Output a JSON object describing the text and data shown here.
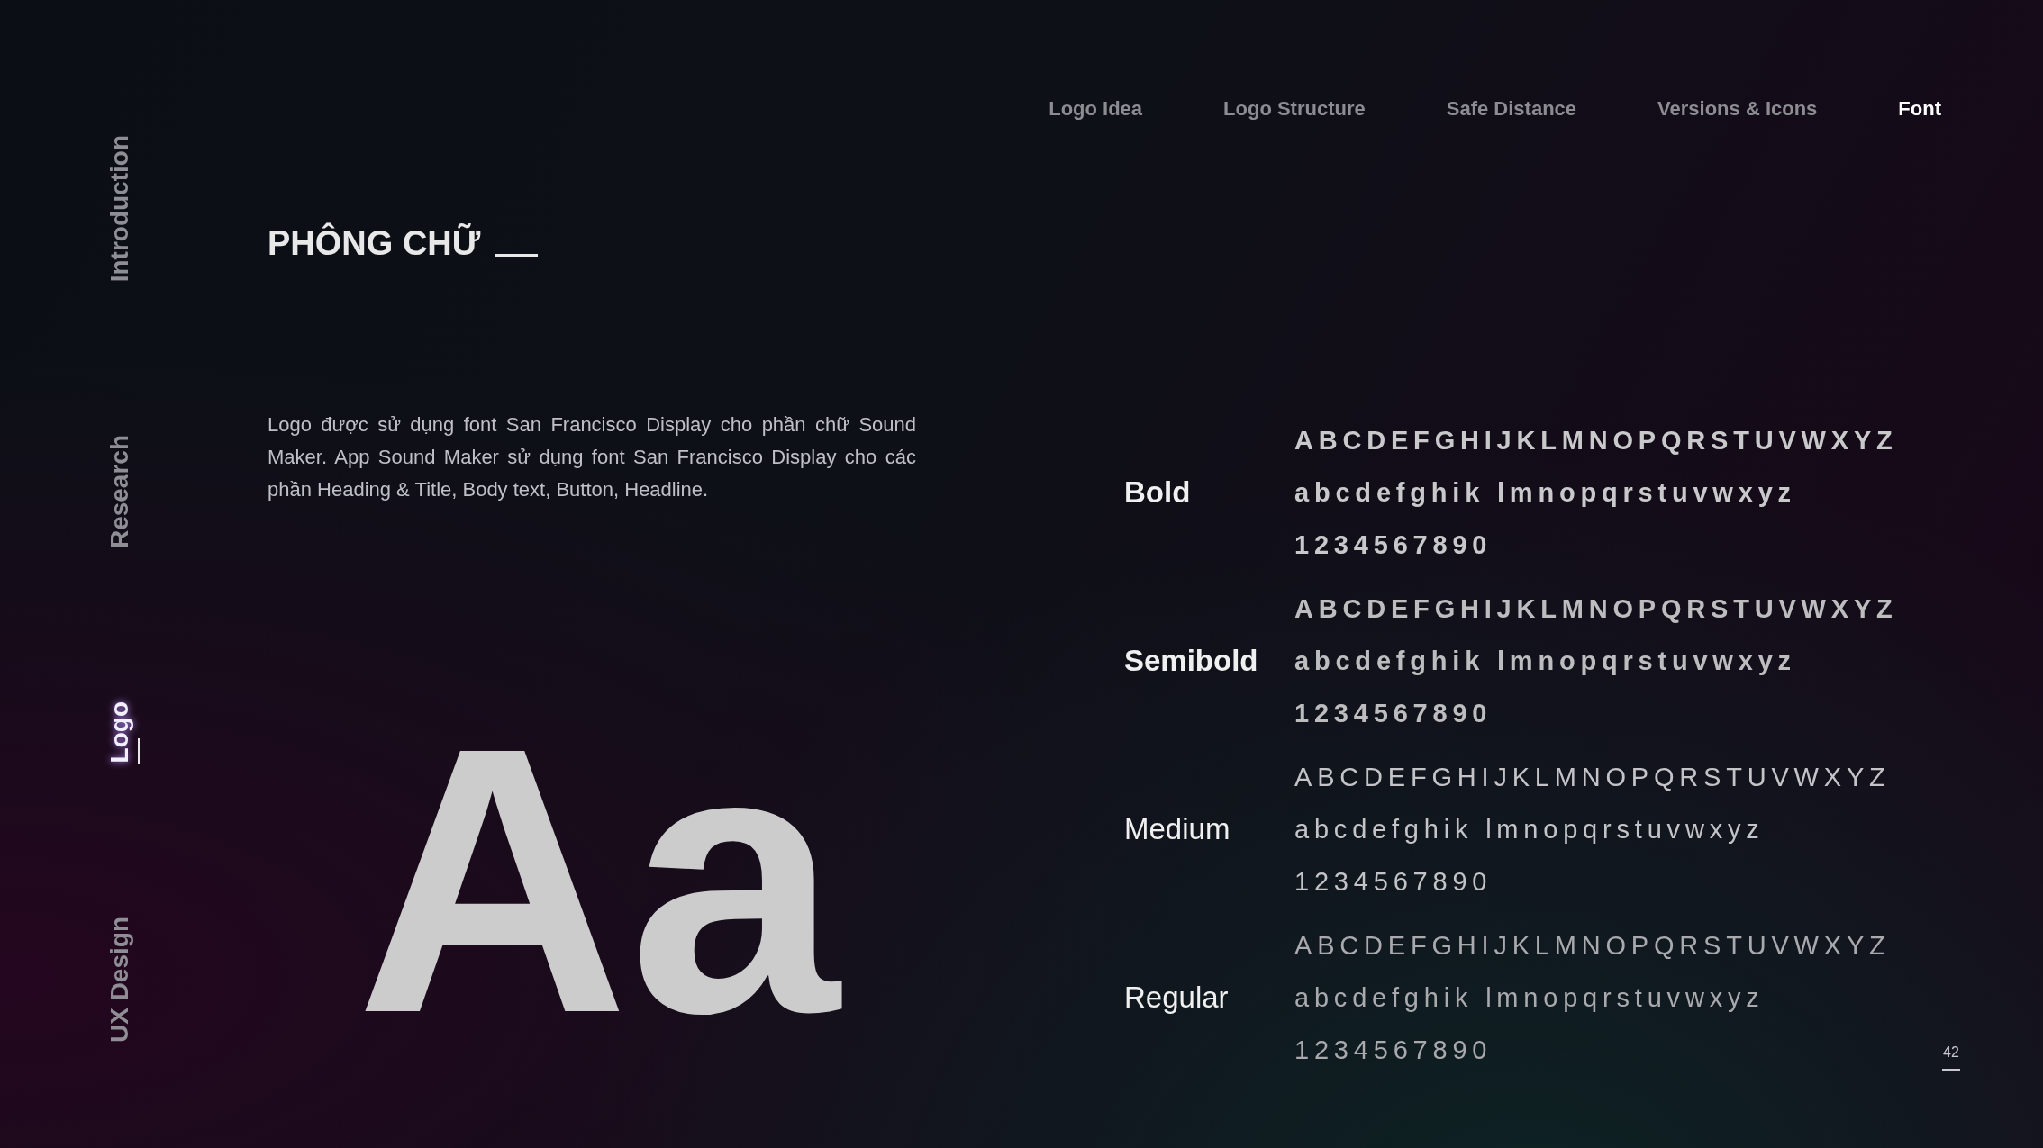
{
  "sidebar": [
    {
      "label": "Introduction",
      "selected": false
    },
    {
      "label": "Research",
      "selected": false
    },
    {
      "label": "Logo",
      "selected": true
    },
    {
      "label": "UX Design",
      "selected": false
    }
  ],
  "nav": [
    {
      "label": "Logo Idea",
      "selected": false
    },
    {
      "label": "Logo Structure",
      "selected": false
    },
    {
      "label": "Safe Distance",
      "selected": false
    },
    {
      "label": "Versions & Icons",
      "selected": false
    },
    {
      "label": "Font",
      "selected": true
    }
  ],
  "title": "PHÔNG CHỮ",
  "description": "Logo được sử dụng font San Francisco Display cho phần chữ Sound Maker. App Sound Maker sử dụng font San Francisco Display cho các phần Heading & Title, Body text, Button, Headline.",
  "specimen": "Aa",
  "weights": [
    {
      "label": "Bold",
      "kind": "bold",
      "lines": [
        "ABCDEFGHIJKLMNOPQRSTUVWXYZ",
        "abcdefghik lmnopqrstuvwxyz",
        "1234567890"
      ]
    },
    {
      "label": "Semibold",
      "kind": "semibold",
      "lines": [
        "ABCDEFGHIJKLMNOPQRSTUVWXYZ",
        "abcdefghik lmnopqrstuvwxyz",
        "1234567890"
      ]
    },
    {
      "label": "Medium",
      "kind": "medium",
      "lines": [
        "ABCDEFGHIJKLMNOPQRSTUVWXYZ",
        "abcdefghik lmnopqrstuvwxyz",
        "1234567890"
      ]
    },
    {
      "label": "Regular",
      "kind": "regular",
      "lines": [
        "ABCDEFGHIJKLMNOPQRSTUVWXYZ",
        "abcdefghik lmnopqrstuvwxyz",
        "1234567890"
      ]
    }
  ],
  "page_number": "42"
}
